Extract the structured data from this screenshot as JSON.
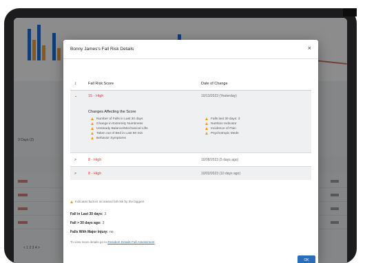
{
  "modal": {
    "title": "Bonny James's Fall Risk Details",
    "close_glyph": "×",
    "table": {
      "sort_glyph": "↕",
      "col_score": "Fall Risk Score",
      "col_date": "Date of Change"
    },
    "expanded_row": {
      "chevron": "⌄",
      "score": "15 - High",
      "date": "10/13/2023 (Yesterday)",
      "changes_title": "Changes Affecting the Score",
      "changes_left": [
        "Number of Falls in Last 30 days",
        "Change in Extremity Numbness",
        "Unsteady Balance/Mechanical Lifts",
        "Taken out of Bed in Last 60 min",
        "Behavior Symptoms"
      ],
      "changes_right": [
        "Falls last 30 days: 3",
        "Nutrition Indicator",
        "Incidence of Pain",
        "Psychotropic Meds"
      ]
    },
    "collapsed_rows": [
      {
        "chevron": ">",
        "score": "8 - High",
        "date": "10/08/2023 (5 days ago)"
      },
      {
        "chevron": ">",
        "score": "8 - High",
        "date": "10/02/2023 (10 days ago)"
      }
    ],
    "note": "Indicates factors increased fall risk by the biggest",
    "stats": [
      {
        "key": "Fall in Last 30 days:",
        "value": "3"
      },
      {
        "key": "Fall > 30 days ago:",
        "value": "3"
      },
      {
        "key": "Falls With Major Injury:",
        "value": "no"
      }
    ],
    "more_prefix": "To view more details go to",
    "more_link": "Resident Details Fall Assessment",
    "ok_label": "OK"
  },
  "background": {
    "tab_label": "3 Days (2)",
    "pager": "< 1 2 3 4 >"
  },
  "colors": {
    "high": "#e53935",
    "warn": "#f39c12",
    "primary": "#2a6ebb"
  }
}
